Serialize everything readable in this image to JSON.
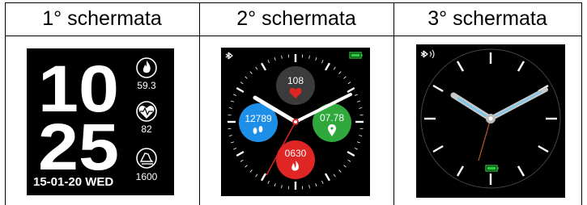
{
  "headers": [
    "1° schermata",
    "2° schermata",
    "3° schermata"
  ],
  "screen1": {
    "hour": "10",
    "minute": "25",
    "date": "15-01-20 WED",
    "calories": "59.3",
    "heart_rate": "82",
    "steps": "1600"
  },
  "screen2": {
    "heart_rate": "108",
    "steps": "12789",
    "distance": "07.78",
    "calories": "0630",
    "colors": {
      "heart": "#3b3b3b",
      "steps": "#1e8fe6",
      "distance": "#2fa93c",
      "calories": "#e02525"
    }
  },
  "screen3": {
    "battery_color": "#2ecc40",
    "hand_accent": "#7fc7e8"
  }
}
